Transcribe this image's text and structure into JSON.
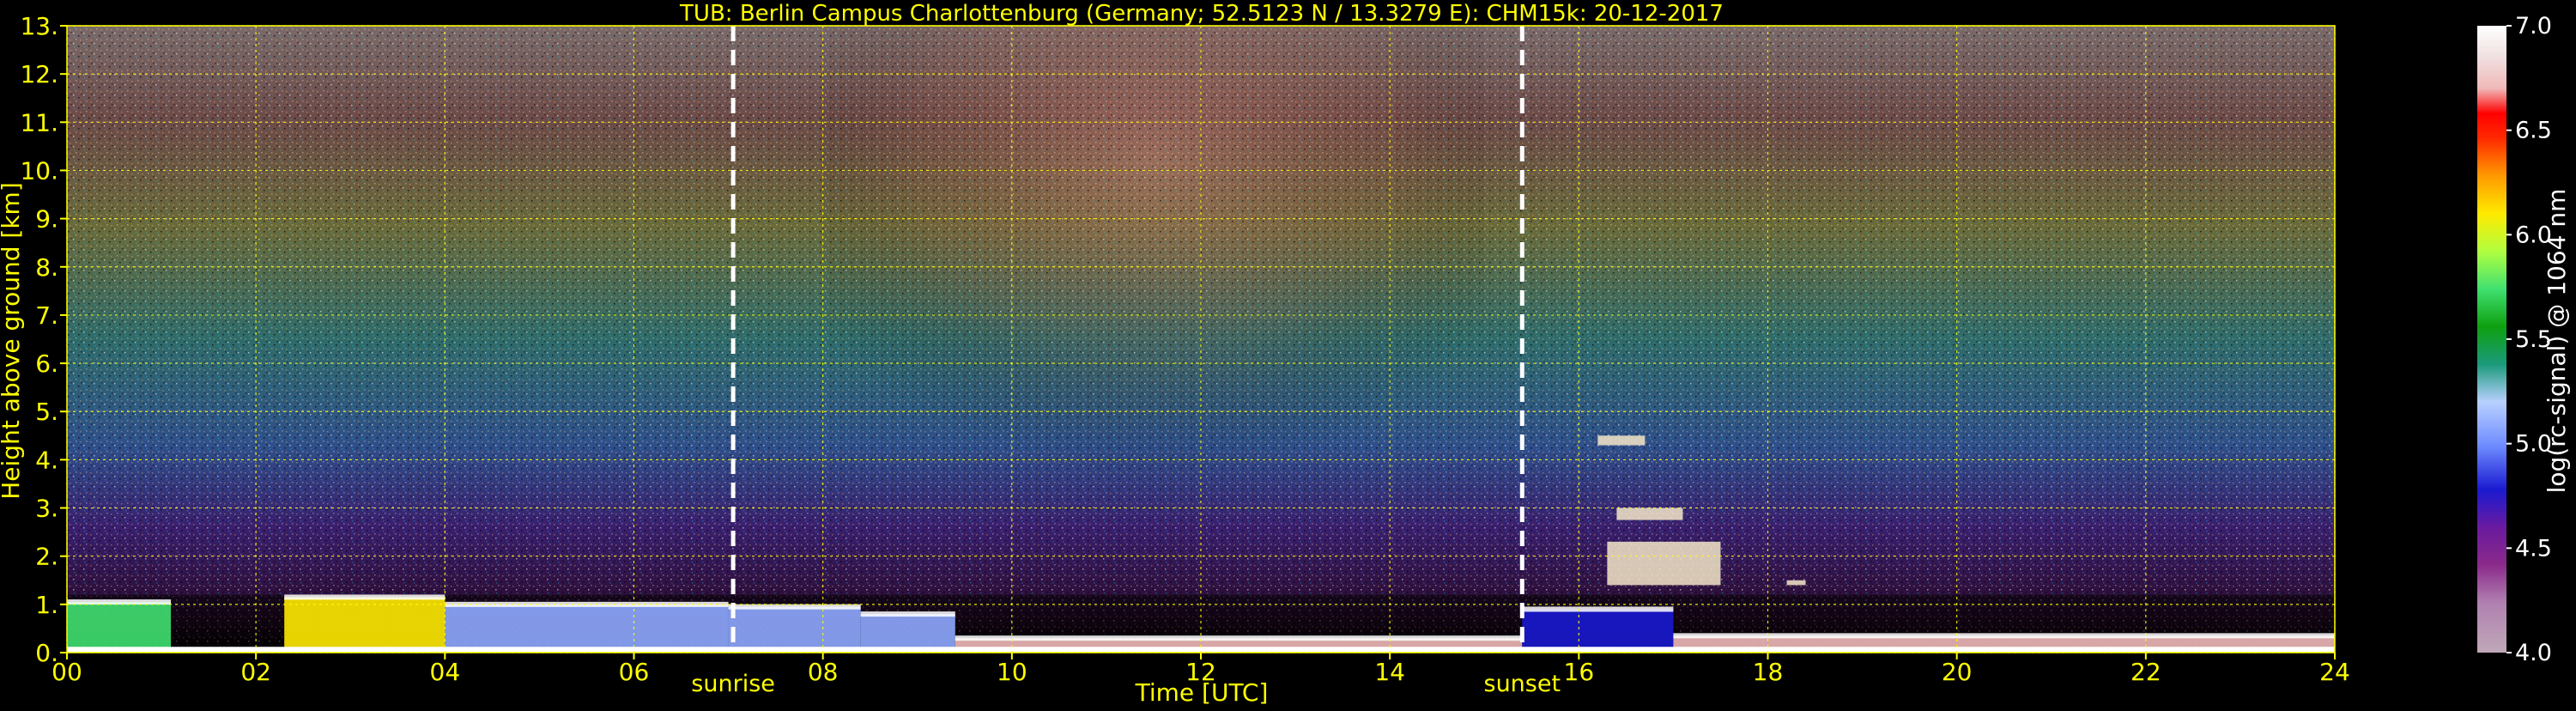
{
  "colors": {
    "background": "#000000",
    "axis_text": "#ffff00",
    "grid": "#ffff00",
    "colorbar_text": "#ffffff",
    "marker_line": "#ffffff"
  },
  "chart_data": {
    "type": "heatmap",
    "title": "TUB: Berlin Campus Charlottenburg (Germany; 52.5123 N / 13.3279 E):    CHM15k: 20-12-2017",
    "xlabel": "Time [UTC]",
    "ylabel": "Height above ground [km]",
    "xlim": [
      0,
      24
    ],
    "ylim": [
      0,
      13
    ],
    "x_ticks": [
      0,
      2,
      4,
      6,
      8,
      10,
      12,
      14,
      16,
      18,
      20,
      22,
      24
    ],
    "x_tick_labels": [
      "00",
      "02",
      "04",
      "06",
      "08",
      "10",
      "12",
      "14",
      "16",
      "18",
      "20",
      "22",
      "24"
    ],
    "y_ticks": [
      0,
      1,
      2,
      3,
      4,
      5,
      6,
      7,
      8,
      9,
      10,
      11,
      12,
      13
    ],
    "y_tick_labels": [
      "0.",
      "1.",
      "2.",
      "3.",
      "4.",
      "5.",
      "6.",
      "7.",
      "8.",
      "9.",
      "10.",
      "11.",
      "12.",
      "13."
    ],
    "grid": true,
    "value_label": "log(rc-signal) @ 1064 nm",
    "colorbar": {
      "label": "log(rc-signal) @ 1064 nm",
      "range": [
        4.0,
        7.0
      ],
      "ticks": [
        4.0,
        4.5,
        5.0,
        5.5,
        6.0,
        6.5,
        7.0
      ],
      "tick_labels": [
        "4.0",
        "4.5",
        "5.0",
        "5.5",
        "6.0",
        "6.5",
        "7.0"
      ],
      "placement": "right"
    },
    "markers": [
      {
        "label": "sunrise",
        "time": 7.05
      },
      {
        "label": "sunset",
        "time": 15.4
      }
    ],
    "features": {
      "boundary_layer": [
        {
          "t0": 0.0,
          "t1": 1.1,
          "top": 1.05,
          "signal": 5.6
        },
        {
          "t0": 2.3,
          "t1": 4.0,
          "top": 1.15,
          "signal": 5.8
        },
        {
          "t0": 4.0,
          "t1": 7.0,
          "top": 1.0,
          "signal": 5.0
        },
        {
          "t0": 7.0,
          "t1": 8.4,
          "top": 0.95,
          "signal": 4.9
        },
        {
          "t0": 8.4,
          "t1": 9.4,
          "top": 0.8,
          "signal": 5.0
        },
        {
          "t0": 9.4,
          "t1": 15.4,
          "top": 0.3,
          "signal": 6.5
        },
        {
          "t0": 15.4,
          "t1": 17.0,
          "top": 0.9,
          "signal": 4.6
        },
        {
          "t0": 17.0,
          "t1": 24.0,
          "top": 0.35,
          "signal": 6.8
        }
      ],
      "cloud_patches": [
        {
          "t0": 16.2,
          "t1": 16.7,
          "h0": 4.3,
          "h1": 4.5
        },
        {
          "t0": 16.4,
          "t1": 17.1,
          "h0": 2.75,
          "h1": 3.0
        },
        {
          "t0": 16.3,
          "t1": 17.5,
          "h0": 1.4,
          "h1": 2.3
        },
        {
          "t0": 18.2,
          "t1": 18.4,
          "h0": 1.4,
          "h1": 1.5
        }
      ]
    }
  }
}
